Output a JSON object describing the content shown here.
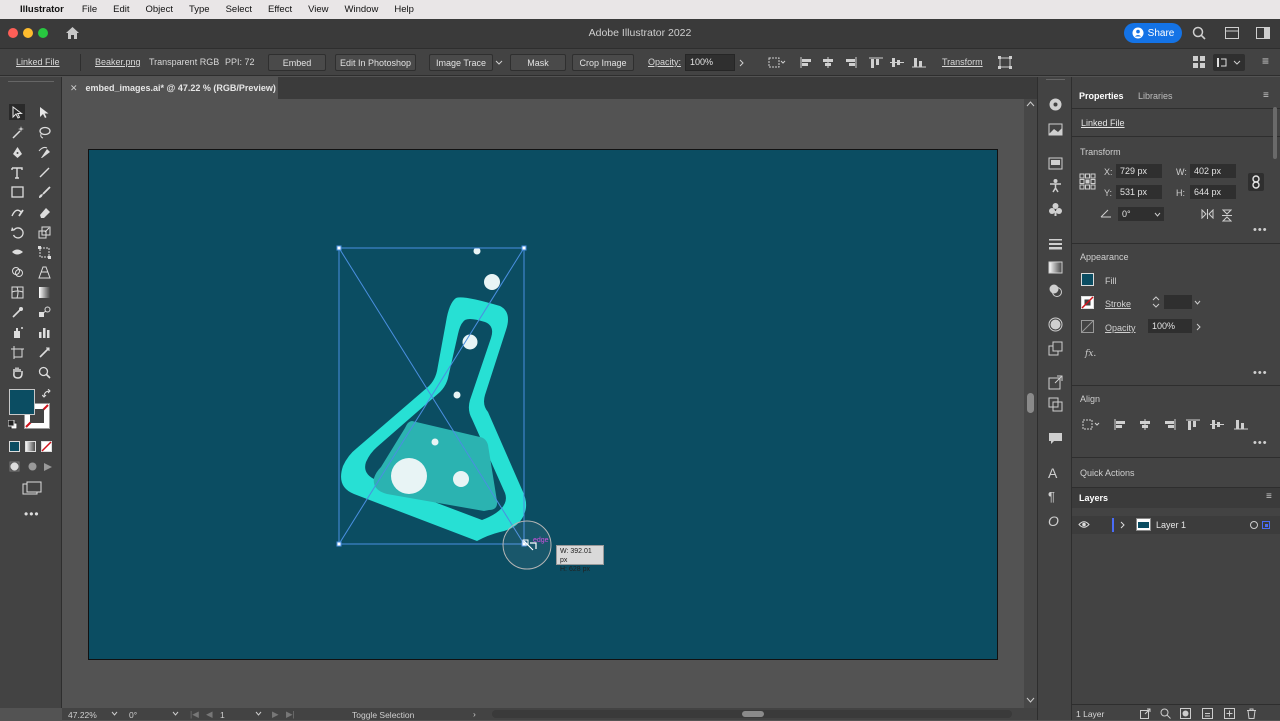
{
  "menubar": {
    "app": "Illustrator",
    "items": [
      "File",
      "Edit",
      "Object",
      "Type",
      "Select",
      "Effect",
      "View",
      "Window",
      "Help"
    ]
  },
  "titlebar": {
    "title": "Adobe Illustrator 2022",
    "share_label": "Share"
  },
  "controlbar": {
    "linked_file": "Linked File",
    "file_name": "Beaker.png",
    "color_mode": "Transparent RGB",
    "ppi": "PPI: 72",
    "embed": "Embed",
    "edit_in_photoshop": "Edit In Photoshop",
    "image_trace": "Image Trace",
    "mask": "Mask",
    "crop_image": "Crop Image",
    "opacity_label": "Opacity:",
    "opacity_value": "100%",
    "transform": "Transform"
  },
  "document": {
    "tab_label": "embed_images.ai* @ 47.22 % (RGB/Preview)"
  },
  "canvas": {
    "tooltip_w": "W: 392.01 px",
    "tooltip_h": "H: 628 px",
    "smart_guide": "edge"
  },
  "statusbar": {
    "zoom": "47.22%",
    "rotation": "0°",
    "artboard": "1",
    "status": "Toggle Selection"
  },
  "properties": {
    "tab_properties": "Properties",
    "tab_libraries": "Libraries",
    "linked_file": "Linked File",
    "transform_title": "Transform",
    "x_label": "X:",
    "x_value": "729 px",
    "y_label": "Y:",
    "y_value": "531 px",
    "w_label": "W:",
    "w_value": "402 px",
    "h_label": "H:",
    "h_value": "644 px",
    "angle_value": "0°",
    "appearance_title": "Appearance",
    "fill_label": "Fill",
    "stroke_label": "Stroke",
    "opacity_label": "Opacity",
    "opacity_value": "100%",
    "fx_label": "fx.",
    "align_title": "Align",
    "quick_actions": "Quick Actions"
  },
  "layers": {
    "title": "Layers",
    "layer_name": "Layer 1",
    "count": "1 Layer"
  },
  "colors": {
    "artboard": "#0b4d62",
    "flask": "#27e0d4",
    "liquid": "#2bb3b1",
    "selection": "#4a8fe0",
    "share": "#1473e6"
  }
}
